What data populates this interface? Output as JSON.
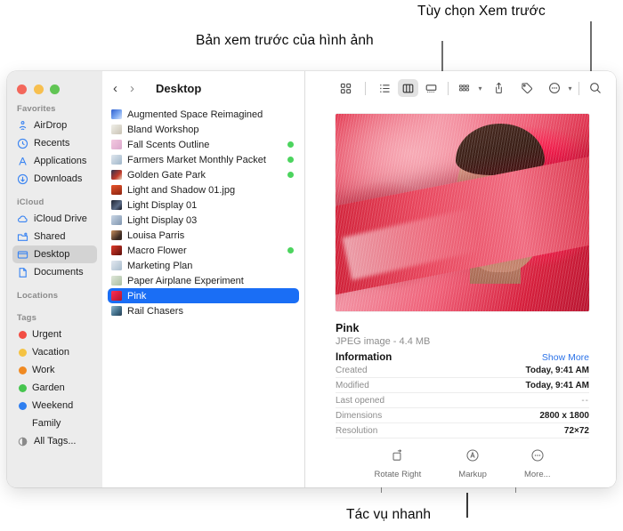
{
  "annotations": {
    "preview_options": "Tùy chọn Xem trước",
    "image_preview": "Bản xem trước của hình ảnh",
    "quick_actions": "Tác vụ nhanh"
  },
  "window": {
    "title": "Desktop",
    "back_icon": "chevron-left-icon",
    "forward_icon": "chevron-right-icon",
    "traffic_lights": [
      "close",
      "minimize",
      "zoom"
    ]
  },
  "toolbar": {
    "views": [
      {
        "name": "icon-view",
        "selected": false
      },
      {
        "name": "list-view",
        "selected": false
      },
      {
        "name": "column-view",
        "selected": true
      },
      {
        "name": "gallery-view",
        "selected": false
      }
    ],
    "actions": [
      {
        "name": "group-by-button",
        "has_chevron": true
      },
      {
        "name": "share-button",
        "has_chevron": false
      },
      {
        "name": "tag-button",
        "has_chevron": false
      },
      {
        "name": "more-button",
        "has_chevron": true
      }
    ],
    "search_icon": "search-icon"
  },
  "sidebar": {
    "sections": [
      {
        "heading": "Favorites",
        "items": [
          {
            "label": "AirDrop",
            "icon": "airdrop-icon",
            "selected": false
          },
          {
            "label": "Recents",
            "icon": "clock-icon",
            "selected": false
          },
          {
            "label": "Applications",
            "icon": "applications-icon",
            "selected": false
          },
          {
            "label": "Downloads",
            "icon": "download-icon",
            "selected": false
          }
        ]
      },
      {
        "heading": "iCloud",
        "items": [
          {
            "label": "iCloud Drive",
            "icon": "cloud-icon",
            "selected": false
          },
          {
            "label": "Shared",
            "icon": "shared-folder-icon",
            "selected": false
          },
          {
            "label": "Desktop",
            "icon": "desktop-icon",
            "selected": true
          },
          {
            "label": "Documents",
            "icon": "document-icon",
            "selected": false
          }
        ]
      },
      {
        "heading": "Locations",
        "items": []
      },
      {
        "heading": "Tags",
        "items": [
          {
            "label": "Urgent",
            "icon": "tag-dot",
            "color": "#f24d43",
            "selected": false
          },
          {
            "label": "Vacation",
            "icon": "tag-dot",
            "color": "#f5c343",
            "selected": false
          },
          {
            "label": "Work",
            "icon": "tag-dot",
            "color": "#f08a22",
            "selected": false
          },
          {
            "label": "Garden",
            "icon": "tag-dot",
            "color": "#46c54f",
            "selected": false
          },
          {
            "label": "Weekend",
            "icon": "tag-dot",
            "color": "#2f7ff0",
            "selected": false
          },
          {
            "label": "Family",
            "icon": "tag-dot",
            "color": "#b martin",
            "selected": false
          },
          {
            "label": "All Tags...",
            "icon": "all-tags-icon",
            "selected": false
          }
        ]
      }
    ]
  },
  "file_list": [
    {
      "name": "Augmented Space Reimagined",
      "tagged": false,
      "selected": false,
      "thumb": "linear-gradient(135deg,#2f5fd0,#7ba7f0 55%,#d8e4fb)"
    },
    {
      "name": "Bland Workshop",
      "tagged": false,
      "selected": false,
      "thumb": "linear-gradient(135deg,#f0efe9,#c9c3b4)"
    },
    {
      "name": "Fall Scents Outline",
      "tagged": true,
      "selected": false,
      "thumb": "linear-gradient(135deg,#f3c9e0,#dba7cc)"
    },
    {
      "name": "Farmers Market Monthly Packet",
      "tagged": true,
      "selected": false,
      "thumb": "linear-gradient(135deg,#dfe6ee,#9fb6c9)"
    },
    {
      "name": "Golden Gate Park",
      "tagged": true,
      "selected": false,
      "thumb": "linear-gradient(135deg,#2b3550,#c23a2a 60%,#e8d9c0)"
    },
    {
      "name": "Light and Shadow 01.jpg",
      "tagged": false,
      "selected": false,
      "thumb": "linear-gradient(160deg,#e8552c,#8c2410)"
    },
    {
      "name": "Light Display 01",
      "tagged": false,
      "selected": false,
      "thumb": "linear-gradient(135deg,#1d2230,#5a6b86 60%,#0f1320)"
    },
    {
      "name": "Light Display 03",
      "tagged": false,
      "selected": false,
      "thumb": "linear-gradient(135deg,#c9d6e6,#7f95ae)"
    },
    {
      "name": "Louisa Parris",
      "tagged": false,
      "selected": false,
      "thumb": "linear-gradient(135deg,#c98f5e,#3a2a22 70%)"
    },
    {
      "name": "Macro Flower",
      "tagged": true,
      "selected": false,
      "thumb": "linear-gradient(135deg,#e03a2a,#5b0f0a)"
    },
    {
      "name": "Marketing Plan",
      "tagged": false,
      "selected": false,
      "thumb": "linear-gradient(135deg,#e3e9f0,#a9bccd)"
    },
    {
      "name": "Paper Airplane Experiment",
      "tagged": false,
      "selected": false,
      "thumb": "linear-gradient(135deg,#dfe7d9,#aabfa2)"
    },
    {
      "name": "Pink",
      "tagged": false,
      "selected": true,
      "thumb": "linear-gradient(135deg,#ff2e52,#b01530)"
    },
    {
      "name": "Rail Chasers",
      "tagged": false,
      "selected": false,
      "thumb": "linear-gradient(135deg,#8fb8cf,#3e6b86 60%,#2a4154)"
    }
  ],
  "preview": {
    "image_alt": "pink-fabric-portrait",
    "file_name": "Pink",
    "file_kind": "JPEG image - 4.4 MB",
    "section_title": "Information",
    "show_more": "Show More",
    "info": [
      {
        "key": "Created",
        "value": "Today, 9:41 AM",
        "dim": false
      },
      {
        "key": "Modified",
        "value": "Today, 9:41 AM",
        "dim": false
      },
      {
        "key": "Last opened",
        "value": "--",
        "dim": true
      },
      {
        "key": "Dimensions",
        "value": "2800 x 1800",
        "dim": false
      },
      {
        "key": "Resolution",
        "value": "72×72",
        "dim": false
      }
    ],
    "quick_actions": [
      {
        "label": "Rotate Right",
        "icon": "rotate-right-icon"
      },
      {
        "label": "Markup",
        "icon": "markup-icon"
      },
      {
        "label": "More...",
        "icon": "more-circle-icon"
      }
    ]
  },
  "colors": {
    "selection_blue": "#1a6ef5",
    "link_blue": "#2b72e8",
    "tag_green": "#4cd45e",
    "sidebar_bg": "#ececec"
  }
}
